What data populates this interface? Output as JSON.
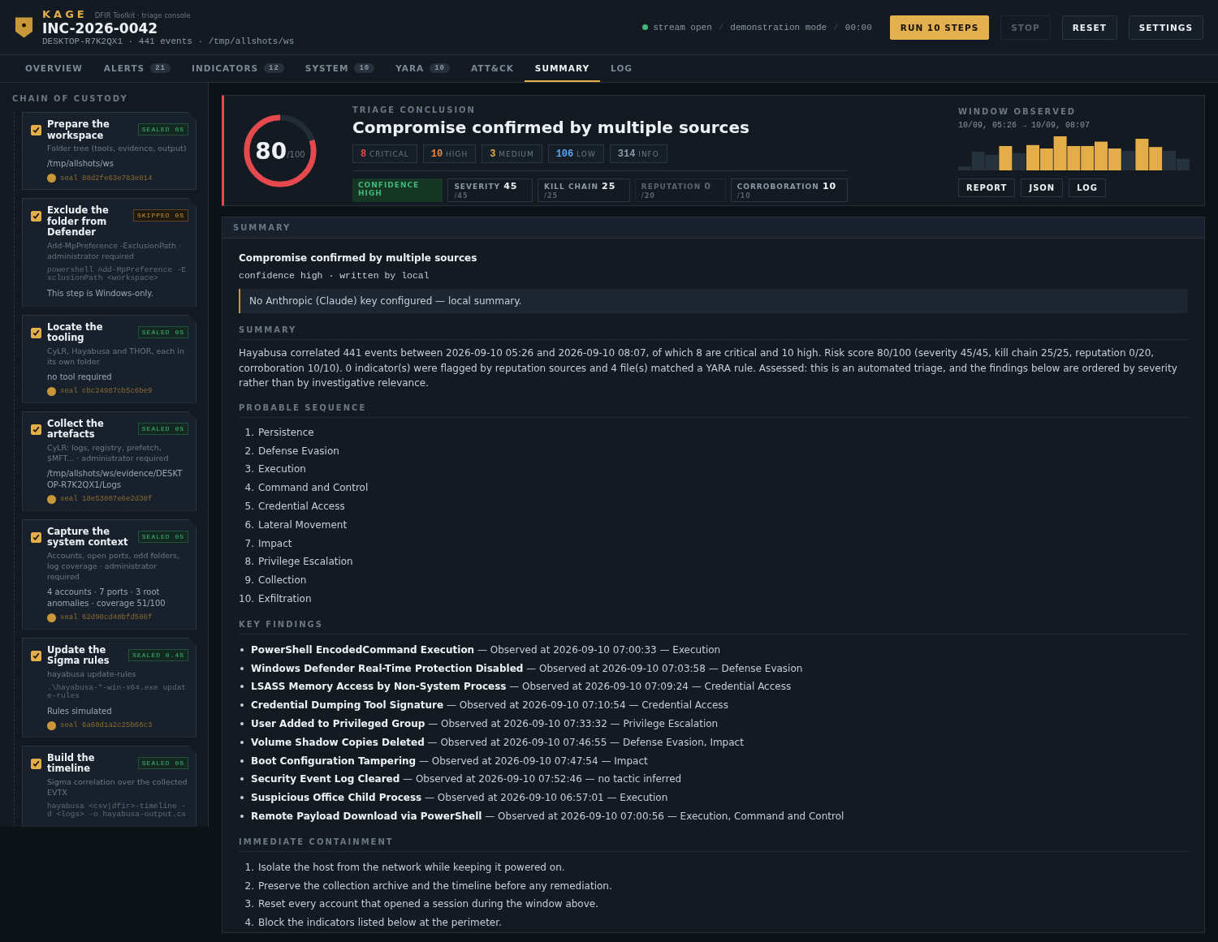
{
  "app": {
    "brand": "KAGE",
    "subtitle": "DFIR Toolkit · triage console",
    "incident": "INC-2026-0042",
    "meta": "DESKTOP-R7K2QX1 · 441 events · /tmp/allshots/ws"
  },
  "status": [
    "stream open",
    "/",
    "demonstration mode",
    "/",
    "00:00"
  ],
  "actions": [
    {
      "label": "RUN 10 STEPS",
      "kind": "primary",
      "disabled": false
    },
    {
      "label": "STOP",
      "kind": "plain",
      "disabled": true
    },
    {
      "label": "RESET",
      "kind": "plain",
      "disabled": false
    },
    {
      "label": "SETTINGS",
      "kind": "plain",
      "disabled": false
    }
  ],
  "tabs": [
    {
      "label": "OVERVIEW",
      "selected": false
    },
    {
      "label": "ALERTS",
      "count": "21",
      "selected": false
    },
    {
      "label": "INDICATORS",
      "count": "12",
      "selected": false
    },
    {
      "label": "SYSTEM",
      "count": "10",
      "selected": false
    },
    {
      "label": "YARA",
      "count": "10",
      "selected": false
    },
    {
      "label": "ATT&CK",
      "selected": false
    },
    {
      "label": "SUMMARY",
      "selected": true
    },
    {
      "label": "LOG",
      "selected": false
    }
  ],
  "sidebar": {
    "title": "CHAIN OF CUSTODY",
    "steps": [
      {
        "title": "Prepare the workspace",
        "skipped": false,
        "badge": "SEALED 0S",
        "checked": true,
        "description": "Folder tree (tools, evidence, output)",
        "result": "/tmp/allshots/ws",
        "seal": "seal 88d2fe63e783e814"
      },
      {
        "title": "Exclude the folder from Defender",
        "skipped": true,
        "badge": "SKIPPED 0S",
        "checked": true,
        "description": "Add-MpPreference -ExclusionPath · administrator required",
        "command": "powershell Add-MpPreference -ExclusionPath <workspace>",
        "result": "This step is Windows-only."
      },
      {
        "title": "Locate the tooling",
        "skipped": false,
        "badge": "SEALED 0S",
        "checked": true,
        "description": "CyLR, Hayabusa and THOR, each in its own folder",
        "result": "no tool required",
        "seal": "seal cbc24987cb5c6be9"
      },
      {
        "title": "Collect the artefacts",
        "skipped": false,
        "badge": "SEALED 0S",
        "checked": true,
        "description": "CyLR: logs, registry, prefetch, $MFT... · administrator required",
        "result": "/tmp/allshots/ws/evidence/DESKTOP-R7K2QX1/Logs",
        "seal": "seal 18e53807e6e2d38f"
      },
      {
        "title": "Capture the system context",
        "skipped": false,
        "badge": "SEALED 0S",
        "checked": true,
        "description": "Accounts, open ports, odd folders, log coverage · administrator required",
        "result": "4 accounts · 7 ports · 3 root anomalies · coverage 51/100",
        "seal": "seal 62d90cd48bfd586f"
      },
      {
        "title": "Update the Sigma rules",
        "skipped": false,
        "badge": "SEALED 0.4S",
        "checked": true,
        "description": "hayabusa update-rules",
        "command": ".\\hayabusa-*-win-x64.exe update-rules",
        "result": "Rules simulated",
        "seal": "seal 6a60d1a2c25b66c3"
      },
      {
        "title": "Build the timeline",
        "skipped": false,
        "badge": "SEALED 0S",
        "checked": true,
        "description": "Sigma correlation over the collected EVTX",
        "command": "hayabusa <csv|dfir>-timeline -d <logs> -o hayabusa-output.cs"
      }
    ]
  },
  "conclusion": {
    "score": "80",
    "score_max": "/100",
    "level": 0.8,
    "label": "TRIAGE CONCLUSION",
    "title": "Compromise confirmed by multiple sources",
    "severities": [
      {
        "count": "8",
        "label": "CRITICAL",
        "color": "#e5484d"
      },
      {
        "count": "10",
        "label": "HIGH",
        "color": "#f0883e"
      },
      {
        "count": "3",
        "label": "MEDIUM",
        "color": "#e3ad4a"
      },
      {
        "count": "106",
        "label": "LOW",
        "color": "#58a6ff"
      },
      {
        "count": "314",
        "label": "INFO",
        "color": "#8b98a8"
      }
    ],
    "confidence": "CONFIDENCE HIGH",
    "scores": [
      {
        "label": "SEVERITY",
        "value": "45",
        "max": "/45",
        "disabled": false
      },
      {
        "label": "KILL CHAIN",
        "value": "25",
        "max": "/25",
        "disabled": false
      },
      {
        "label": "REPUTATION",
        "value": "0",
        "max": "/20",
        "disabled": true
      },
      {
        "label": "CORROBORATION",
        "value": "10",
        "max": "/10",
        "disabled": false
      }
    ],
    "window_label": "WINDOW OBSERVED",
    "window_range": "10/09, 05:26 → 10/09, 08:07",
    "exports": [
      "REPORT",
      "JSON",
      "LOG"
    ]
  },
  "summary": {
    "header": "SUMMARY",
    "title": "Compromise confirmed by multiple sources",
    "meta": "confidence high · written by local",
    "notice": "No Anthropic (Claude) key configured — local summary.",
    "sections": [
      {
        "kind": "paragraph",
        "heading": "SUMMARY",
        "text": "Hayabusa correlated 441 events between 2026-09-10 05:26 and 2026-09-10 08:07, of which 8 are critical and 10 high. Risk score 80/100 (severity 45/45, kill chain 25/25, reputation 0/20, corroboration 10/10). 0 indicator(s) were flagged by reputation sources and 4 file(s) matched a YARA rule. Assessed: this is an automated triage, and the findings below are ordered by severity rather than by investigative relevance."
      },
      {
        "kind": "numbered",
        "heading": "PROBABLE SEQUENCE",
        "items": [
          {
            "number": "1.",
            "text": "Persistence"
          },
          {
            "number": "2.",
            "text": "Defense Evasion"
          },
          {
            "number": "3.",
            "text": "Execution"
          },
          {
            "number": "4.",
            "text": "Command and Control"
          },
          {
            "number": "5.",
            "text": "Credential Access"
          },
          {
            "number": "6.",
            "text": "Lateral Movement"
          },
          {
            "number": "7.",
            "text": "Impact"
          },
          {
            "number": "8.",
            "text": "Privilege Escalation"
          },
          {
            "number": "9.",
            "text": "Collection"
          },
          {
            "number": "10.",
            "text": "Exfiltration"
          }
        ]
      },
      {
        "kind": "bullets",
        "heading": "KEY FINDINGS",
        "items": [
          "**PowerShell EncodedCommand Execution** — Observed at 2026-09-10 07:00:33 — Execution",
          "**Windows Defender Real-Time Protection Disabled** — Observed at 2026-09-10 07:03:58 — Defense Evasion",
          "**LSASS Memory Access by Non-System Process** — Observed at 2026-09-10 07:09:24 — Credential Access",
          "**Credential Dumping Tool Signature** — Observed at 2026-09-10 07:10:54 — Credential Access",
          "**User Added to Privileged Group** — Observed at 2026-09-10 07:33:32 — Privilege Escalation",
          "**Volume Shadow Copies Deleted** — Observed at 2026-09-10 07:46:55 — Defense Evasion, Impact",
          "**Boot Configuration Tampering** — Observed at 2026-09-10 07:47:54 — Impact",
          "**Security Event Log Cleared** — Observed at 2026-09-10 07:52:46 — no tactic inferred",
          "**Suspicious Office Child Process** — Observed at 2026-09-10 06:57:01 — Execution",
          "**Remote Payload Download via PowerShell** — Observed at 2026-09-10 07:00:56 — Execution, Command and Control"
        ]
      },
      {
        "kind": "numbered",
        "heading": "IMMEDIATE CONTAINMENT",
        "items": [
          {
            "number": "1.",
            "text": "Isolate the host from the network while keeping it powered on."
          },
          {
            "number": "2.",
            "text": "Preserve the collection archive and the timeline before any remediation."
          },
          {
            "number": "3.",
            "text": "Reset every account that opened a session during the window above."
          },
          {
            "number": "4.",
            "text": "Block the indicators listed below at the perimeter."
          }
        ]
      }
    ]
  }
}
